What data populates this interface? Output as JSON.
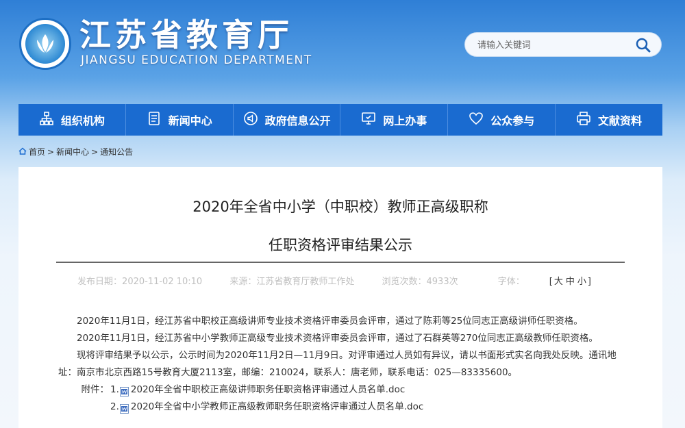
{
  "header": {
    "title": "江苏省教育厅",
    "subtitle": "JIANGSU EDUCATION DEPARTMENT",
    "search_placeholder": "请输入关键词"
  },
  "nav": [
    {
      "label": "组织机构",
      "icon": "org-chart-icon"
    },
    {
      "label": "新闻中心",
      "icon": "document-icon"
    },
    {
      "label": "政府信息公开",
      "icon": "megaphone-icon"
    },
    {
      "label": "网上办事",
      "icon": "monitor-icon"
    },
    {
      "label": "公众参与",
      "icon": "heart-icon"
    },
    {
      "label": "文献资料",
      "icon": "printer-icon"
    }
  ],
  "breadcrumb": {
    "home": "首页",
    "sep": ">",
    "items": [
      "新闻中心",
      "通知公告"
    ]
  },
  "article": {
    "title_line1": "2020年全省中小学（中职校）教师正高级职称",
    "title_line2": "任职资格评审结果公示",
    "meta": {
      "date": "发布日期：2020-11-02 10:10",
      "source": "来源：江苏省教育厅教师工作处",
      "views": "浏览次数：4933次",
      "font_label": "字体：",
      "font_sizes": [
        "大",
        "中",
        "小"
      ]
    },
    "paragraphs": [
      "2020年11月1日，经江苏省中职校正高级讲师专业技术资格评审委员会评审，通过了陈莉等25位同志正高级讲师任职资格。",
      "2020年11月1日，经江苏省中小学教师正高级专业技术资格评审委员会评审，通过了石群英等270位同志正高级教师任职资格。",
      "现将评审结果予以公示，公示时间为2020年11月2日—11月9日。对评审通过人员如有异议，请以书面形式实名向我处反映。通讯地址：南京市北京西路15号教育大厦2113室，邮编：210024，联系人：唐老师，联系电话：025—83335600。"
    ],
    "attachments_label": "附件：",
    "attachments": [
      {
        "num": "1.",
        "name": "2020年全省中职校正高级讲师职务任职资格评审通过人员名单.doc"
      },
      {
        "num": "2.",
        "name": "2020年全省中小学教师正高级教师职务任职资格评审通过人员名单.doc"
      }
    ]
  },
  "colors": {
    "nav_bg": "#1a6bd0",
    "header_bg": "#2f7fd6"
  }
}
